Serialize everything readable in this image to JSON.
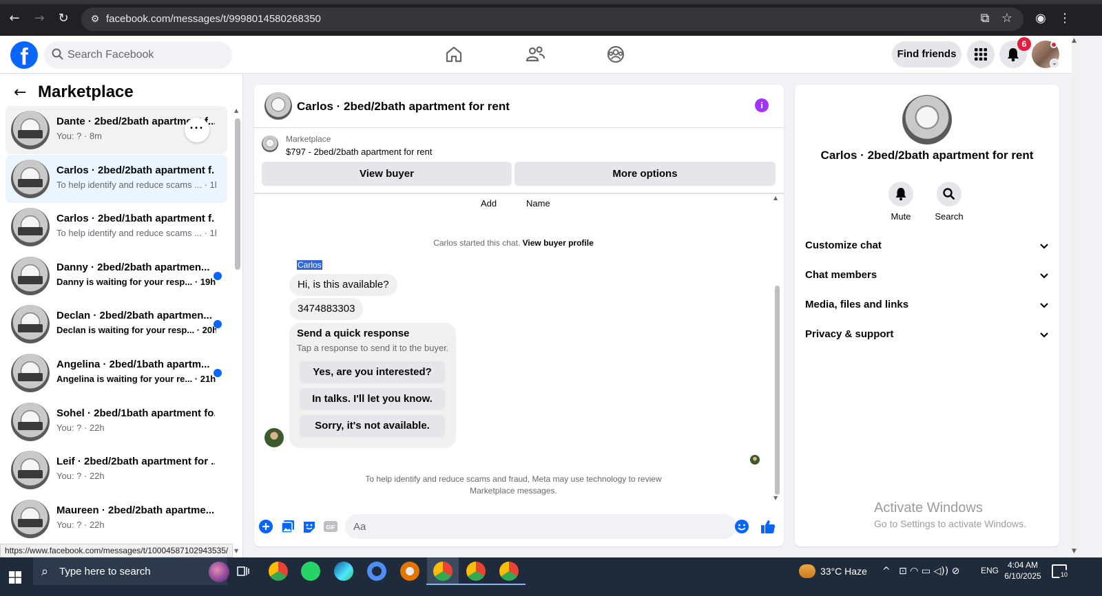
{
  "browser": {
    "url": "facebook.com/messages/t/9998014580268350"
  },
  "header": {
    "search_placeholder": "Search Facebook",
    "find_friends": "Find friends",
    "notification_count": "6"
  },
  "sidebar": {
    "title": "Marketplace",
    "conversations": [
      {
        "name": "Dante · 2bed/2bath apartment f...",
        "preview": "You: ? · 8m",
        "unread": false
      },
      {
        "name": "Carlos · 2bed/2bath apartment f...",
        "preview": "To help identify and reduce scams ... · 1h",
        "unread": false
      },
      {
        "name": "Carlos · 2bed/1bath apartment f...",
        "preview": "To help identify and reduce scams ... · 1h",
        "unread": false
      },
      {
        "name": "Danny · 2bed/2bath apartmen...",
        "preview": "Danny is waiting for your resp... · 19h",
        "unread": true
      },
      {
        "name": "Declan · 2bed/2bath apartmen...",
        "preview": "Declan is waiting for your resp... · 20h",
        "unread": true
      },
      {
        "name": "Angelina · 2bed/1bath apartm...",
        "preview": "Angelina is waiting for your re... · 21h",
        "unread": true
      },
      {
        "name": "Sohel · 2bed/1bath apartment fo...",
        "preview": "You: ? · 22h",
        "unread": false
      },
      {
        "name": "Leif · 2bed/2bath apartment for ...",
        "preview": "You: ? · 22h",
        "unread": false
      },
      {
        "name": "Maureen · 2bed/2bath apartme...",
        "preview": "You: ? · 22h",
        "unread": false
      }
    ],
    "status_url": "https://www.facebook.com/messages/t/10004587102943535/"
  },
  "chat": {
    "title": "Carlos · 2bed/2bath apartment for rent",
    "listing_source": "Marketplace",
    "listing_title": "$797 - 2bed/2bath apartment for rent",
    "view_buyer": "View buyer",
    "more_options": "More options",
    "cut_label_add": "Add",
    "cut_label_name": "Name",
    "started_text": "Carlos started this chat.",
    "view_buyer_profile": "View buyer profile",
    "sender": "Carlos",
    "messages": [
      "Hi, is this available?",
      "3474883303"
    ],
    "quick_title": "Send a quick response",
    "quick_subtitle": "Tap a response to send it to the buyer.",
    "quick_replies": [
      "Yes, are you interested?",
      "In talks. I'll let you know.",
      "Sorry, it's not available."
    ],
    "notice": "To help identify and reduce scams and fraud, Meta may use technology to review Marketplace messages.",
    "composer_placeholder": "Aa"
  },
  "details": {
    "title": "Carlos · 2bed/2bath apartment for rent",
    "mute": "Mute",
    "search": "Search",
    "sections": [
      "Customize chat",
      "Chat members",
      "Media, files and links",
      "Privacy & support"
    ]
  },
  "watermark": {
    "line1": "Activate Windows",
    "line2": "Go to Settings to activate Windows."
  },
  "taskbar": {
    "search_text": "Type here to search",
    "weather": "33°C  Haze",
    "lang": "ENG",
    "time": "4:04 AM",
    "date": "6/10/2025",
    "notify_count": "10"
  },
  "colors": {
    "fb_blue": "#0866ff",
    "unread_dot": "#0866ff",
    "notif_red": "#e41e3f",
    "info_purple": "#a033ff"
  }
}
